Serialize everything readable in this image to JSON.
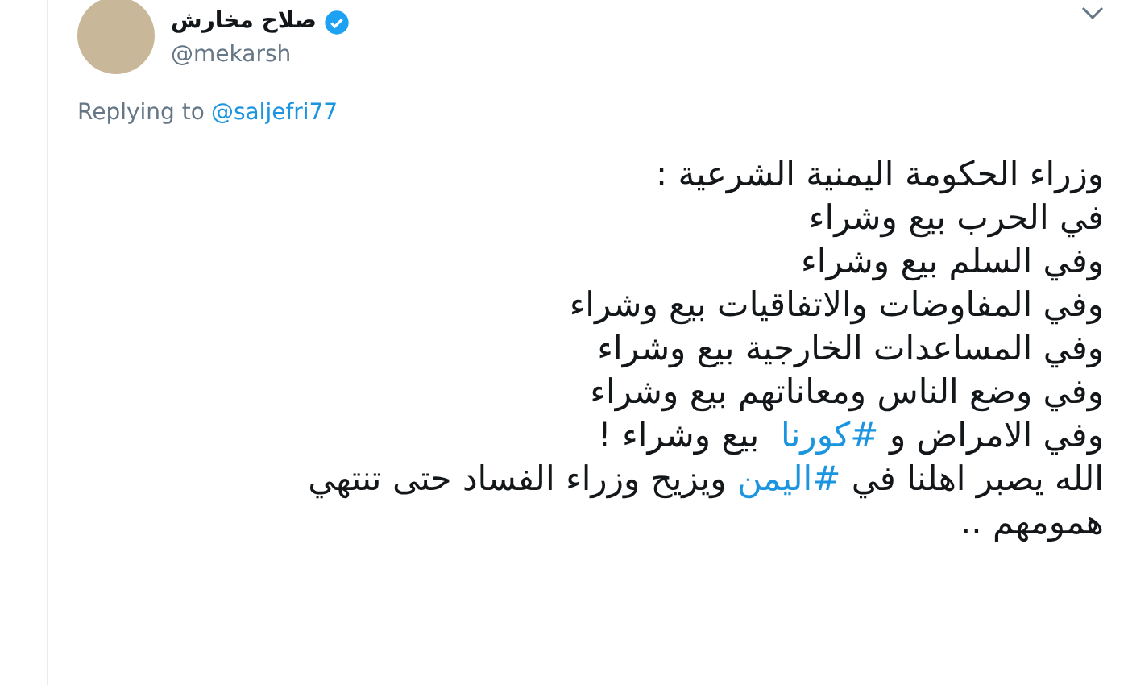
{
  "author": {
    "name": "صلاح مخارش",
    "verified": true,
    "handle": "@mekarsh"
  },
  "reply": {
    "label": "Replying to",
    "mention": "@saljefri77"
  },
  "lines": [
    [
      {
        "kind": "text",
        "text": "وزراء الحكومة اليمنية الشرعية :"
      }
    ],
    [
      {
        "kind": "text",
        "text": "في الحرب بيع وشراء"
      }
    ],
    [
      {
        "kind": "text",
        "text": "وفي السلم بيع وشراء"
      }
    ],
    [
      {
        "kind": "text",
        "text": "وفي المفاوضات والاتفاقيات بيع وشراء"
      }
    ],
    [
      {
        "kind": "text",
        "text": "وفي المساعدات الخارجية بيع وشراء"
      }
    ],
    [
      {
        "kind": "text",
        "text": "وفي وضع الناس ومعاناتهم بيع وشراء"
      }
    ],
    [
      {
        "kind": "text",
        "text": "وفي الامراض و "
      },
      {
        "kind": "hashtag",
        "text": "#كورنا"
      },
      {
        "kind": "text",
        "text": "  بيع وشراء !"
      }
    ],
    [
      {
        "kind": "text",
        "text": "الله يصبر اهلنا في "
      },
      {
        "kind": "hashtag",
        "text": "#اليمن"
      },
      {
        "kind": "text",
        "text": " ويزيح وزراء الفساد حتى تنتهي"
      }
    ],
    [
      {
        "kind": "text",
        "text": "همومهم .."
      }
    ]
  ]
}
